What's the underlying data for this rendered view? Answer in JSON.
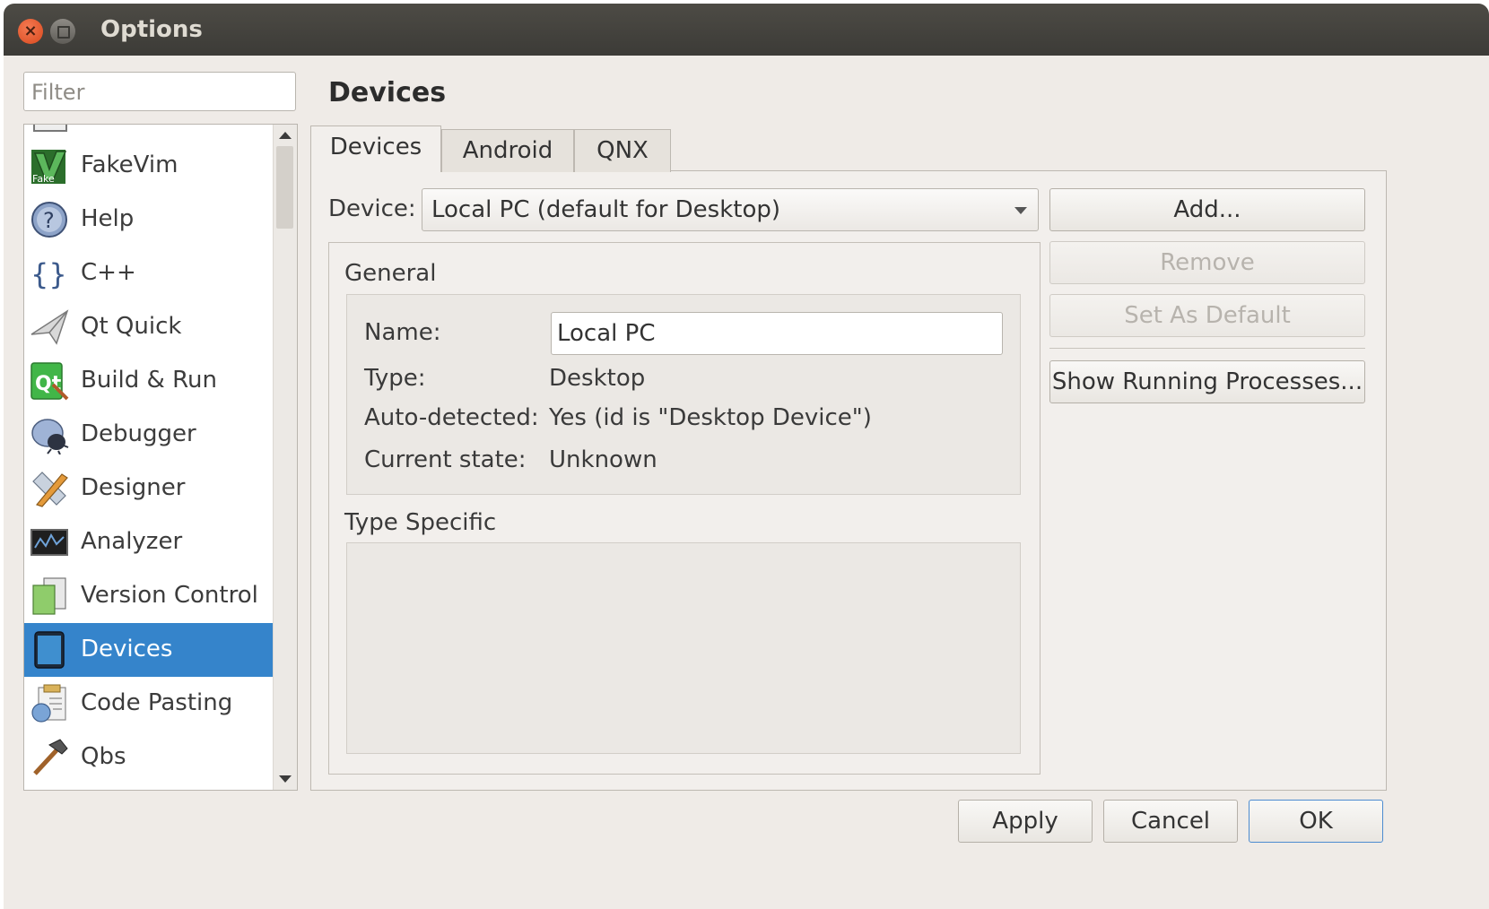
{
  "window": {
    "title": "Options"
  },
  "filter": {
    "placeholder": "Filter"
  },
  "categories": [
    {
      "label": "FakeVim",
      "icon": "fakevim-icon"
    },
    {
      "label": "Help",
      "icon": "help-icon"
    },
    {
      "label": "C++",
      "icon": "cpp-braces-icon"
    },
    {
      "label": "Qt Quick",
      "icon": "qt-quick-plane-icon"
    },
    {
      "label": "Build & Run",
      "icon": "build-run-icon"
    },
    {
      "label": "Debugger",
      "icon": "debugger-bug-icon"
    },
    {
      "label": "Designer",
      "icon": "designer-pencil-icon"
    },
    {
      "label": "Analyzer",
      "icon": "analyzer-screen-icon"
    },
    {
      "label": "Version Control",
      "icon": "version-control-icon"
    },
    {
      "label": "Devices",
      "icon": "devices-tablet-icon",
      "selected": true
    },
    {
      "label": "Code Pasting",
      "icon": "code-pasting-icon"
    },
    {
      "label": "Qbs",
      "icon": "qbs-hammer-icon"
    }
  ],
  "page": {
    "title": "Devices"
  },
  "tabs": [
    {
      "label": "Devices",
      "active": true
    },
    {
      "label": "Android"
    },
    {
      "label": "QNX"
    }
  ],
  "device_selector": {
    "label": "Device:",
    "value": "Local PC (default for Desktop)"
  },
  "buttons": {
    "add": "Add...",
    "remove": "Remove",
    "set_default": "Set As Default",
    "show_processes": "Show Running Processes..."
  },
  "general": {
    "heading": "General",
    "name_label": "Name:",
    "name_value": "Local PC",
    "type_label": "Type:",
    "type_value": "Desktop",
    "auto_label": "Auto-detected:",
    "auto_value": "Yes (id is \"Desktop Device\")",
    "state_label": "Current state:",
    "state_value": "Unknown"
  },
  "type_specific": {
    "heading": "Type Specific"
  },
  "footer": {
    "apply": "Apply",
    "cancel": "Cancel",
    "ok": "OK"
  },
  "colors": {
    "selection": "#3584cb",
    "titlebar": "#3c3b37",
    "close": "#e35f2c"
  }
}
